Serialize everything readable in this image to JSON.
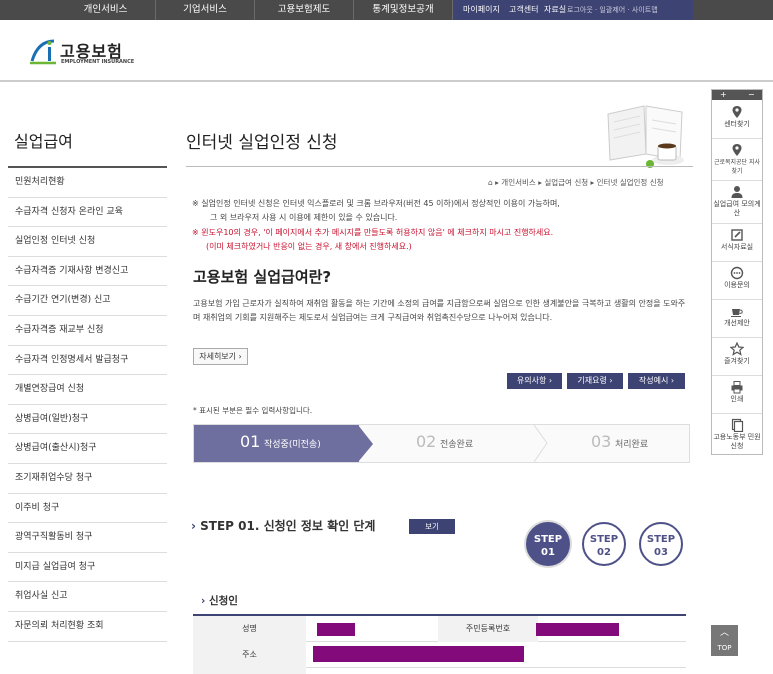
{
  "gnb": {
    "items": [
      "개인서비스",
      "기업서비스",
      "고용보험제도",
      "통계및정보공개"
    ],
    "right": [
      "마이페이지",
      "고객센터",
      "자료실"
    ],
    "util": "로그아웃 · 일괄제어 · 사이트맵"
  },
  "logo": {
    "title": "고용보험",
    "sub": "EMPLOYMENT INSURANCE"
  },
  "lnb": {
    "title": "실업급여",
    "items": [
      "민원처리현황",
      "수급자격 신청자 온라인 교육",
      "실업인정 인터넷 신청",
      "수급자격증 기재사항 변경신고",
      "수급기간 연기(변경) 신고",
      "수급자격증 재교부 신청",
      "수급자격 인정명세서 발급청구",
      "개별연장급여 신청",
      "상병급여(일반)청구",
      "상병급여(출산시)청구",
      "조기재취업수당 청구",
      "이주비 청구",
      "광역구직활동비 청구",
      "미지급 실업급여 청구",
      "취업사실 신고",
      "자문의뢰 처리현황 조회"
    ]
  },
  "main": {
    "title": "인터넷 실업인정 신청",
    "breadcrumb": "▸ 개인서비스 ▸ 실업급여 신청 ▸ 인터넷 실업인정 신청",
    "note1": "※ 실업인정 인터넷 신청은 인터넷 익스플로러 및 크롬 브라우저(버전 45 이하)에서 정상적인 이용이 가능하며,",
    "note2": "그 외 브라우저 사용 시 이용에 제한이 있을 수 있습니다.",
    "note3": "※ 윈도우10의 경우, '이 페이지에서 추가 메시지를 만들도록 허용하지 않음' 에 체크하지 마시고 진행하세요.",
    "note4": "(이미 체크하였거나 반응이 없는 경우, 새 창에서 진행하세요.)",
    "section_title": "고용보험 실업급여란?",
    "desc": "고용보험 가입 근로자가 실직하여 재취업 활동을 하는 기간에 소정의 급여를 지급함으로써 실업으로 인한 생계불안을 극복하고 생활의 안정을 도와주며 재취업의 기회를 지원해주는 제도로서 실업급여는 크게 구직급여와 취업촉진수당으로 나누어져 있습니다.",
    "more": "자세히보기 ›",
    "buttons": [
      "유의사항 ›",
      "기재요령 ›",
      "작성예시 ›"
    ],
    "required": "* 표시된 부분은 필수 입력사항입니다.",
    "steps": [
      {
        "num": "01",
        "label": "작성중(미전송)"
      },
      {
        "num": "02",
        "label": "전송완료"
      },
      {
        "num": "03",
        "label": "처리완료"
      }
    ],
    "step_heading": "STEP 01. 신청인 정보 확인 단계",
    "view_btn": "보기",
    "circles": [
      {
        "line1": "STEP",
        "line2": "01"
      },
      {
        "line1": "STEP",
        "line2": "02"
      },
      {
        "line1": "STEP",
        "line2": "03"
      }
    ],
    "applicant_title": "신청인",
    "fields": {
      "name": "성명",
      "rrn": "주민등록번호",
      "address": "주소"
    }
  },
  "quick": {
    "items": [
      {
        "icon": "map-pin-icon",
        "label": "센터찾기"
      },
      {
        "icon": "map-pin-icon",
        "label": "근로복지공단 지사찾기"
      },
      {
        "icon": "person-icon",
        "label": "실업급여 모의계산"
      },
      {
        "icon": "pencil-icon",
        "label": "서식자료실"
      },
      {
        "icon": "chat-icon",
        "label": "이용문의"
      },
      {
        "icon": "coffee-icon",
        "label": "개선제안"
      },
      {
        "icon": "star-icon",
        "label": "즐겨찾기"
      },
      {
        "icon": "print-icon",
        "label": "인쇄"
      },
      {
        "icon": "document-icon",
        "label": "고용노동부 민원신청"
      }
    ],
    "top": "TOP"
  },
  "colors": {
    "accent": "#3d4373",
    "step_active": "#6f6f9f",
    "mask": "#820a7a",
    "warn": "#c8102e"
  }
}
